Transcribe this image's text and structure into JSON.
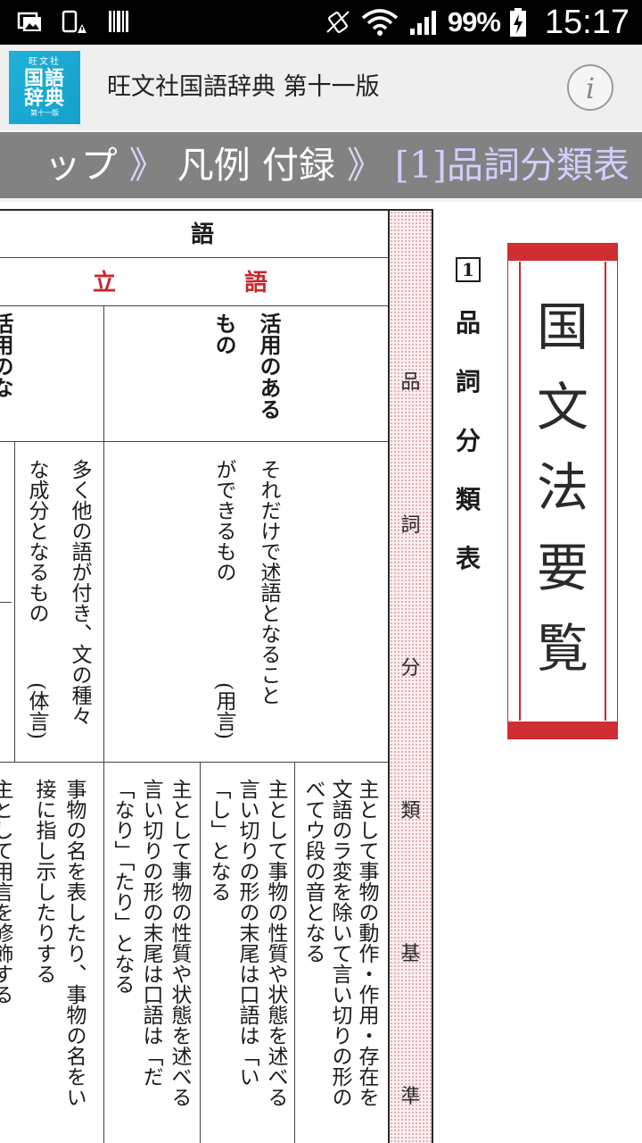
{
  "status_bar": {
    "battery_percent": "99%",
    "time": "15:17",
    "icons": [
      "photo-notification-icon",
      "device-warning-icon",
      "barcode-icon",
      "vibrate-icon",
      "wifi-icon",
      "signal-icon",
      "battery-charging-icon"
    ]
  },
  "app_bar": {
    "logo": {
      "small": "旺文社",
      "line1": "国語",
      "line2": "辞典",
      "edition": "第十一版"
    },
    "title": "旺文社国語辞典 第十一版",
    "info_icon": "info-icon"
  },
  "breadcrumb": {
    "part1": "ップ",
    "sep1": "》",
    "part2": "凡例 付録",
    "sep2": "》",
    "current": "[1]品詞分類表"
  },
  "table": {
    "top_header": "語",
    "second_header_left": "立",
    "second_header_right": "語",
    "row3_right": "活用のある",
    "row3_right_2": "もの",
    "row3_left_partial": "活用のな",
    "row4_right_1": "それだけで述語となること",
    "row4_right_2": "ができるもの",
    "row4_right_tag": "(用言)",
    "row4_left_1": "多く他の語が付き、文の種々",
    "row4_left_2": "な成分となるもの",
    "row4_left_tag": "(体言)",
    "verb_1": "主として事物の動作・作用・存在を",
    "verb_2": "文語のラ変を除いて言い切りの形の",
    "verb_3": "べてウ段の音となる",
    "adj_1": "主として事物の性質や状態を述べる",
    "adj_2": "言い切りの形の末尾は口語は「い",
    "adj_3": "「し」となる",
    "adjv_1": "主として事物の性質や状態を述べる",
    "adjv_2": "言い切りの形の末尾は口語は「だ",
    "adjv_3": "「なり」「たり」となる",
    "noun_1": "事物の名を表したり、事物の名をい",
    "noun_2": "接に指し示したりする",
    "far_left_partial": "主として用言を修飾する"
  },
  "band": {
    "label_chars": [
      "品",
      "詞",
      "分",
      "類",
      "基",
      "準"
    ]
  },
  "side_title": {
    "number": "1",
    "chars": [
      "品",
      "詞",
      "分",
      "類",
      "表"
    ]
  },
  "kokubun_box": {
    "chars": [
      "国",
      "文",
      "法",
      "要",
      "覧"
    ]
  },
  "colors": {
    "accent_red": "#c8282d",
    "logo_blue": "#14a0cb",
    "breadcrumb_bg": "#828282"
  }
}
